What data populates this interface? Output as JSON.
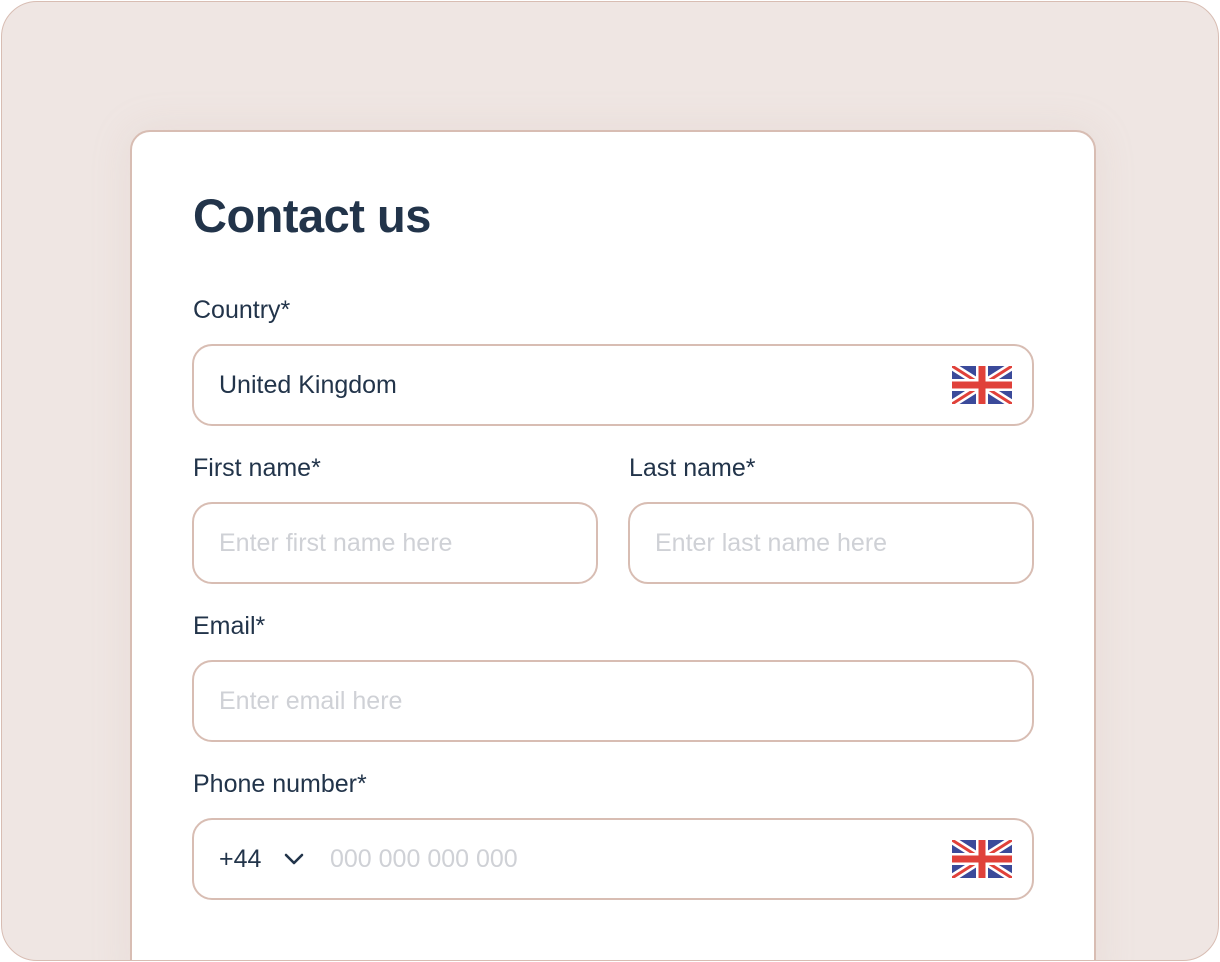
{
  "form": {
    "title": "Contact us",
    "country": {
      "label": "Country*",
      "value": "United Kingdom",
      "flag_icon": "uk-flag-icon"
    },
    "first_name": {
      "label": "First name*",
      "placeholder": "Enter first name here"
    },
    "last_name": {
      "label": "Last name*",
      "placeholder": "Enter last name here"
    },
    "email": {
      "label": "Email*",
      "placeholder": "Enter email here"
    },
    "phone": {
      "label": "Phone number*",
      "dial_code": "+44",
      "placeholder": "000 000 000 000",
      "flag_icon": "uk-flag-icon"
    }
  },
  "colors": {
    "background": "#efe6e3",
    "border": "#d8bdb3",
    "text": "#22344a",
    "placeholder": "#cfd1d6",
    "flag_blue": "#3b4a9a",
    "flag_red": "#e0413a"
  }
}
